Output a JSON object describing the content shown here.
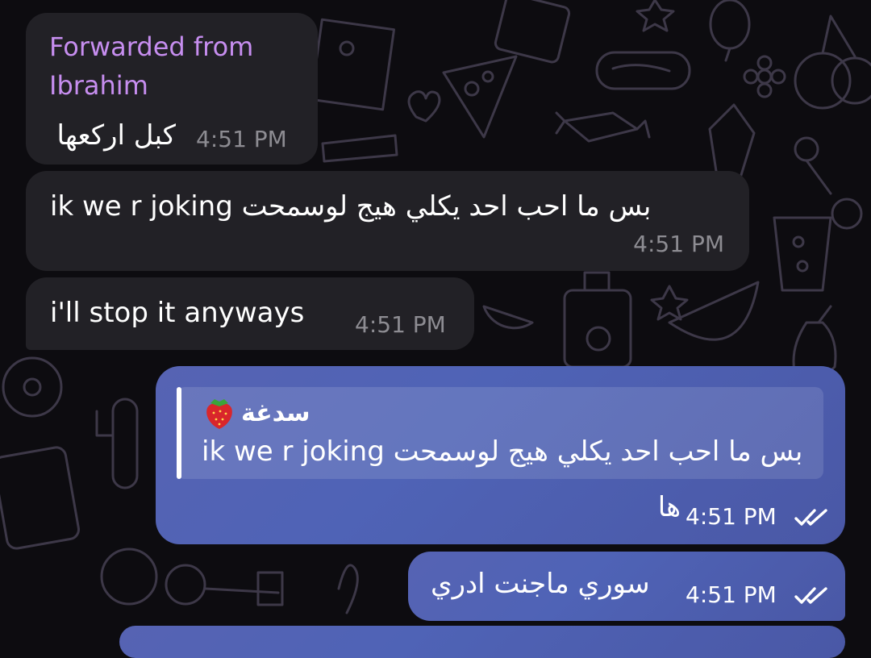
{
  "messages": [
    {
      "direction": "incoming",
      "forwarded_label": "Forwarded from Ibrahim",
      "text": "كبل اركعها",
      "time": "4:51 PM"
    },
    {
      "direction": "incoming",
      "text": "بس ما احب احد يكلي هيج لوسمحت ik we r joking",
      "time": "4:51 PM"
    },
    {
      "direction": "incoming",
      "text": "i'll stop it anyways",
      "time": "4:51 PM"
    },
    {
      "direction": "outgoing",
      "reply": {
        "author": "سدغة",
        "emoji": "strawberry-icon",
        "text": "بس ما احب احد يكلي هيج لوسمحت ik we r joking"
      },
      "text": "ها",
      "time": "4:51 PM",
      "status": "read-checks-icon"
    },
    {
      "direction": "outgoing",
      "text": "سوري ماجنت ادري",
      "time": "4:51 PM",
      "status": "read-checks-icon"
    }
  ],
  "colors": {
    "background": "#0d0c10",
    "incoming_bubble": "#222126",
    "outgoing_bubble": "#5663b3",
    "forwarded_label": "#c78ef0",
    "incoming_time": "#8d8c92"
  }
}
